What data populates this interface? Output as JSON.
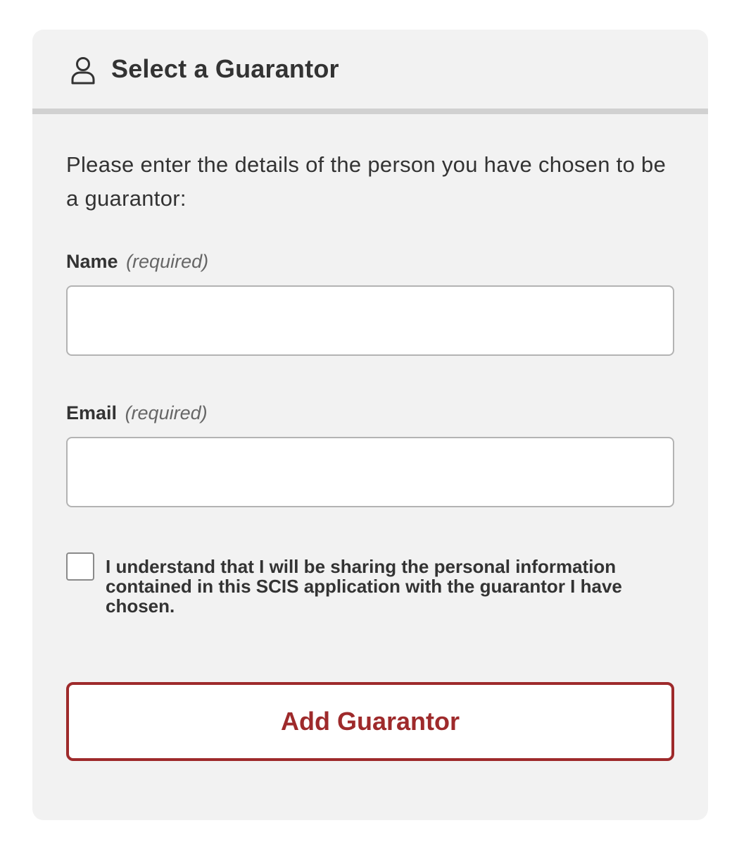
{
  "header": {
    "icon": "person-icon",
    "title": "Select a Guarantor"
  },
  "form": {
    "intro": "Please enter the details of the person you have chosen to be a guarantor:",
    "name_field": {
      "label": "Name",
      "required_text": "(required)",
      "value": "",
      "placeholder": ""
    },
    "email_field": {
      "label": "Email",
      "required_text": "(required)",
      "value": "",
      "placeholder": ""
    },
    "consent": {
      "checked": false,
      "text": "I understand that I will be sharing the personal information contained in this SCIS application with the guarantor I have chosen."
    },
    "submit_label": "Add Guarantor"
  },
  "colors": {
    "accent": "#9e2a2b",
    "card_background": "#f2f2f2",
    "header_divider": "#d1d1d1",
    "text": "#333333"
  }
}
